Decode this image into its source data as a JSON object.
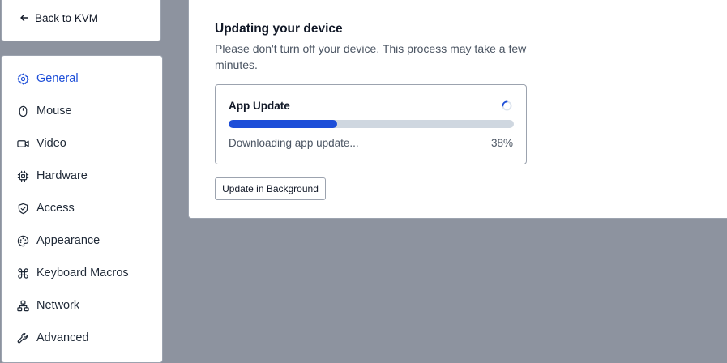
{
  "back": {
    "label": "Back to KVM",
    "icon": "arrow-left-icon"
  },
  "sidebar": {
    "items": [
      {
        "label": "General",
        "icon": "gear-icon",
        "active": true
      },
      {
        "label": "Mouse",
        "icon": "mouse-icon"
      },
      {
        "label": "Video",
        "icon": "video-camera-icon"
      },
      {
        "label": "Hardware",
        "icon": "chip-icon"
      },
      {
        "label": "Access",
        "icon": "shield-icon"
      },
      {
        "label": "Appearance",
        "icon": "palette-icon"
      },
      {
        "label": "Keyboard Macros",
        "icon": "command-key-icon"
      },
      {
        "label": "Network",
        "icon": "network-icon"
      },
      {
        "label": "Advanced",
        "icon": "wrench-icon"
      }
    ]
  },
  "update": {
    "title": "Updating your device",
    "subtitle": "Please don't turn off your device. This process may take a few minutes.",
    "app_update": {
      "title": "App Update",
      "status": "Downloading app update...",
      "percent_label": "38%",
      "progress": 0.38
    },
    "background_button": "Update in Background"
  },
  "colors": {
    "accent": "#1d4ed8",
    "backdrop": "#8d939f",
    "track": "#cfd7e0"
  }
}
